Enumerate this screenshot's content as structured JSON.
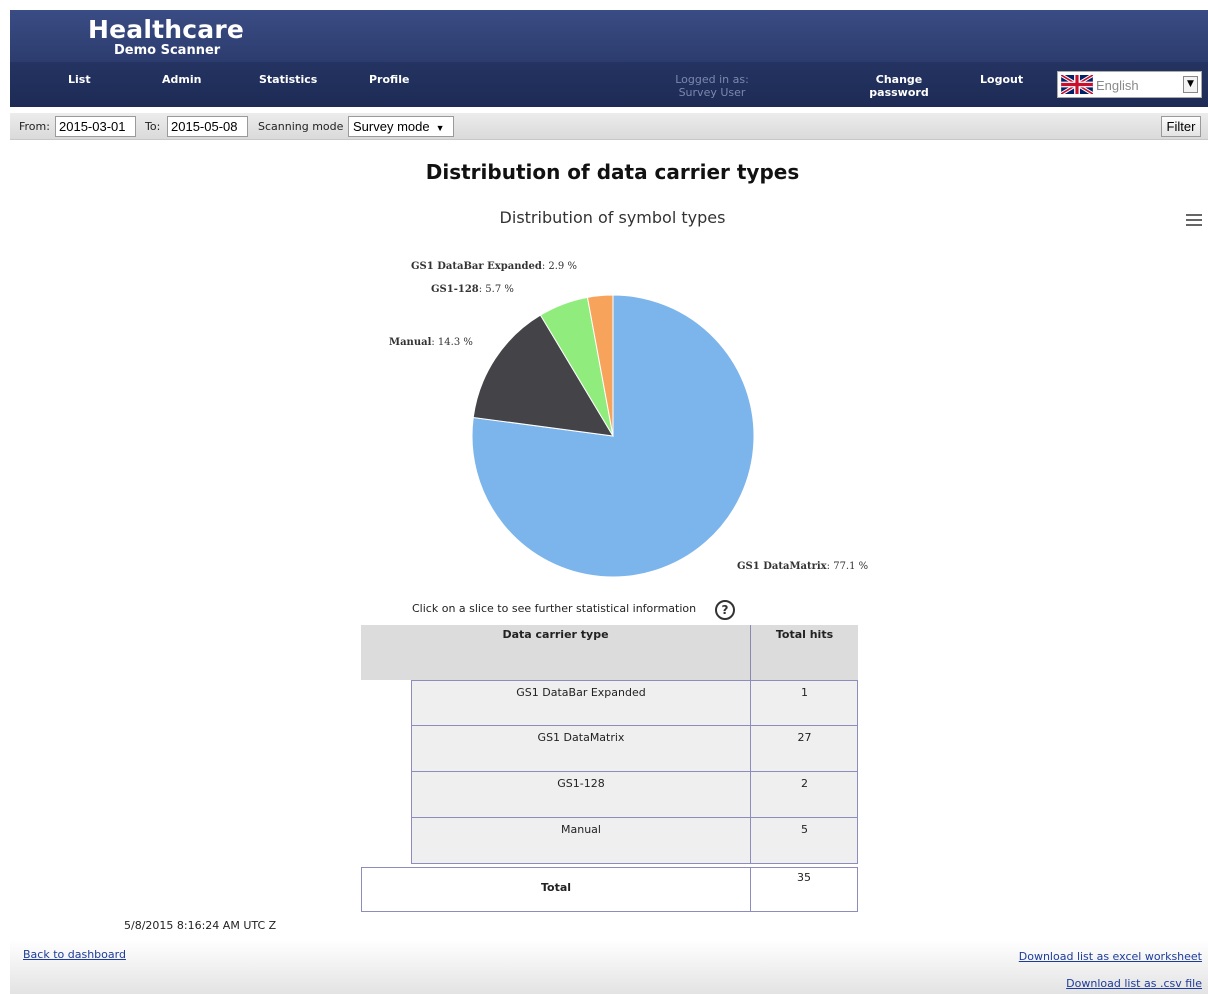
{
  "header": {
    "logo_line1": "Healthcare",
    "logo_line2": "Demo Scanner",
    "nav": {
      "list": "List",
      "admin": "Admin",
      "statistics": "Statistics",
      "profile": "Profile"
    },
    "logged_in_label": "Logged in as:",
    "logged_in_user": "Survey User",
    "change_password_line1": "Change",
    "change_password_line2": "password",
    "logout": "Logout",
    "language": {
      "selected": "English",
      "icon": "uk-flag-icon"
    }
  },
  "filter_bar": {
    "from_label": "From:",
    "from_value": "2015-03-01",
    "to_label": "To:",
    "to_value": "2015-05-08",
    "mode_label": "Scanning mode",
    "mode_value": "Survey mode",
    "filter_button": "Filter"
  },
  "page_title": "Distribution of data carrier types",
  "chart_menu_icon": "hamburger-menu-icon",
  "chart_data": {
    "type": "pie",
    "title": "Distribution of symbol types",
    "slices": [
      {
        "name": "GS1 DataMatrix",
        "value": 77.1,
        "label": ": 77.1 %",
        "color": "#7cb5ec"
      },
      {
        "name": "Manual",
        "value": 14.3,
        "label": ": 14.3 %",
        "color": "#434348"
      },
      {
        "name": "GS1-128",
        "value": 5.7,
        "label": ": 5.7 %",
        "color": "#90ed7d"
      },
      {
        "name": "GS1 DataBar Expanded",
        "value": 2.9,
        "label": ": 2.9 %",
        "color": "#f7a35c"
      }
    ]
  },
  "hint": "Click on a slice to see further statistical information",
  "help_icon": "question-mark-icon",
  "table": {
    "headers": [
      "Data carrier type",
      "Total hits"
    ],
    "rows": [
      {
        "type": "GS1 DataBar Expanded",
        "hits": "1"
      },
      {
        "type": "GS1 DataMatrix",
        "hits": "27"
      },
      {
        "type": "GS1-128",
        "hits": "2"
      },
      {
        "type": "Manual",
        "hits": "5"
      }
    ],
    "total_label": "Total",
    "total_value": "35"
  },
  "timestamp": "5/8/2015 8:16:24 AM UTC Z",
  "footer": {
    "back_link": "Back to dashboard",
    "excel_link": "Download list as excel worksheet",
    "csv_link": "Download list as .csv file"
  }
}
